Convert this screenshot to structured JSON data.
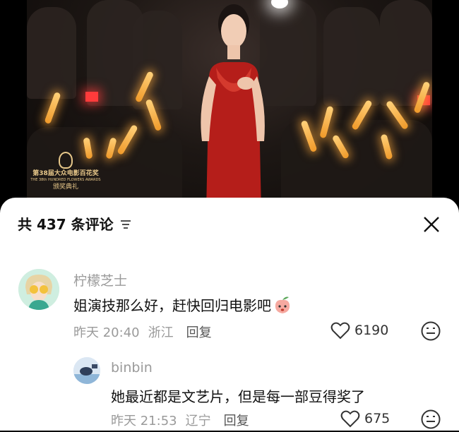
{
  "video": {
    "award_line1": "第38届大众电影百花奖",
    "award_line2": "THE 38th HUNDRED FLOWERS AWARDS",
    "award_line3": "颁奖典礼"
  },
  "comments_panel": {
    "title": "共 437 条评论",
    "sort_icon": "sort-icon",
    "close_icon": "close-icon"
  },
  "comments": [
    {
      "user": "柠檬芝士",
      "text": "姐演技那么好，赶快回归电影吧",
      "time": "昨天 20:40",
      "location": "浙江",
      "reply_label": "回复",
      "likes": "6190"
    },
    {
      "user": "binbin",
      "text": "她最近都是文艺片，但是每一部豆得奖了",
      "time": "昨天 21:53",
      "location": "辽宁",
      "reply_label": "回复",
      "likes": "675"
    }
  ],
  "colors": {
    "accent_red": "#c8271f",
    "muted_text": "#9a9a9a"
  }
}
